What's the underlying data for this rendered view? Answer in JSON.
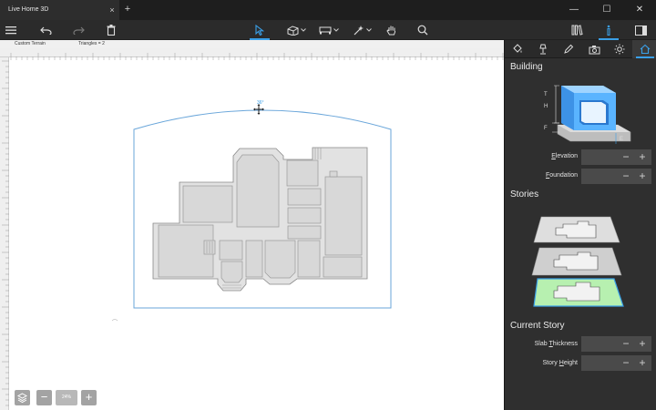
{
  "titlebar": {
    "tab_title": "Live Home 3D",
    "tab_close": "×",
    "new_tab": "+",
    "minimize": "—",
    "maximize": "☐",
    "close": "✕"
  },
  "canvas": {
    "terrain_label": "Custom Terrain",
    "triangles_label": "Triangles = 2",
    "angle_label": "36°",
    "zoom_out": "−",
    "zoom_level": "24%",
    "zoom_in": "+"
  },
  "panel": {
    "building_title": "Building",
    "dimension_letters": {
      "t": "T",
      "h": "H",
      "f": "F",
      "e": "E"
    },
    "elevation_label": "Elevation",
    "elevation_key": "E",
    "elevation_rest": "levation",
    "foundation_label": "Foundation",
    "foundation_key": "F",
    "foundation_rest": "oundation",
    "stories_title": "Stories",
    "current_story_title": "Current Story",
    "slab_a": "Slab ",
    "slab_key": "T",
    "slab_b": "hickness",
    "story_a": "Story ",
    "story_key": "H",
    "story_b": "eight",
    "minus": "−",
    "plus": "+"
  },
  "colors": {
    "accent": "#3aa0e8",
    "panel_bg": "#2f2f2f",
    "selected_story": "#b7f0b0",
    "room_fill": "#e2e2e2"
  }
}
